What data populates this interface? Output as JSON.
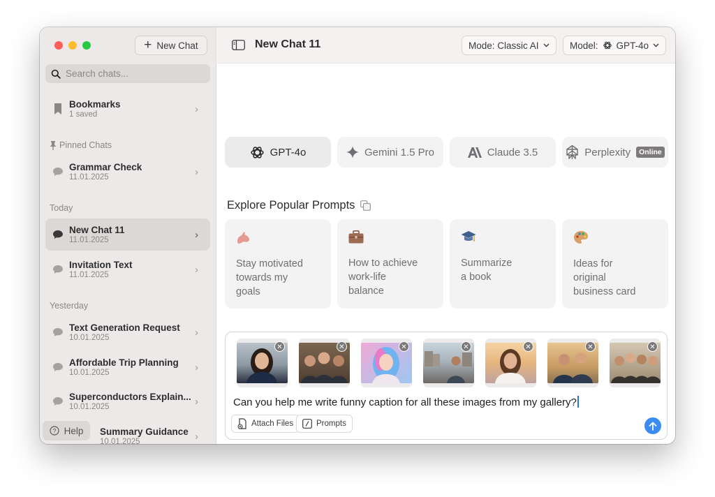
{
  "sidebar": {
    "new_chat_label": "New Chat",
    "search_placeholder": "Search chats...",
    "bookmarks": {
      "title": "Bookmarks",
      "sub": "1 saved"
    },
    "pinned_label": "Pinned Chats",
    "today_label": "Today",
    "yesterday_label": "Yesterday",
    "items": [
      {
        "title": "Grammar Check",
        "date": "11.01.2025"
      },
      {
        "title": "New Chat 11",
        "date": "11.01.2025"
      },
      {
        "title": "Invitation Text",
        "date": "11.01.2025"
      },
      {
        "title": "Text Generation Request",
        "date": "10.01.2025"
      },
      {
        "title": "Affordable Trip Planning",
        "date": "10.01.2025"
      },
      {
        "title": "Superconductors Explain...",
        "date": "10.01.2025"
      },
      {
        "title": "Summary Guidance",
        "date": "10.01.2025"
      }
    ],
    "help_label": "Help"
  },
  "header": {
    "chat_title": "New Chat 11",
    "mode_label": "Mode: Classic AI",
    "model_prefix": "Model:",
    "model_value": "GPT-4o"
  },
  "models": [
    {
      "name": "GPT-4o"
    },
    {
      "name": "Gemini 1.5 Pro"
    },
    {
      "name": "Claude 3.5"
    },
    {
      "name": "Perplexity",
      "badge": "Online"
    }
  ],
  "explore_title": "Explore Popular Prompts",
  "prompt_cards": [
    {
      "text": "Stay motivated\ntowards my\ngoals",
      "icon": "flexed-arm-icon"
    },
    {
      "text": "How to achieve\nwork-life\nbalance",
      "icon": "briefcase-icon"
    },
    {
      "text": "Summarize\na book",
      "icon": "graduation-cap-icon"
    },
    {
      "text": "Ideas for\noriginal\nbusiness card",
      "icon": "palette-icon"
    }
  ],
  "composer": {
    "message": "Can you help me write funny caption for all these images from my gallery?",
    "attach_label": "Attach Files",
    "prompts_label": "Prompts",
    "attachments": 7
  },
  "colors": {
    "accent": "#3b8cf0",
    "sidebar_bg": "#ece9e8",
    "topbar_bg": "#f6f1f1"
  }
}
